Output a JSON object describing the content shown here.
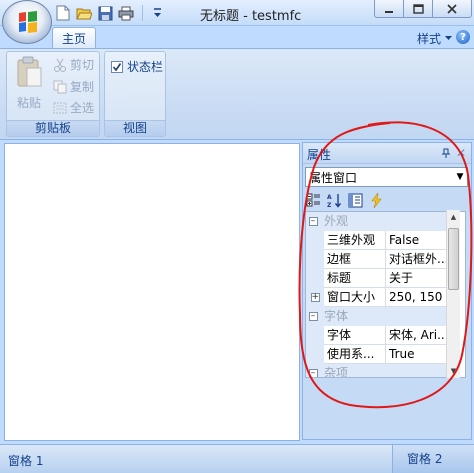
{
  "window": {
    "title": "无标题 - testmfc"
  },
  "quick_access": {
    "icons": [
      "new-file-icon",
      "open-folder-icon",
      "save-icon",
      "print-icon",
      "customize-dropdown-icon"
    ]
  },
  "ribbon": {
    "tabs": [
      {
        "label": "主页",
        "selected": true
      }
    ],
    "style_menu_label": "样式",
    "groups": {
      "clipboard": {
        "label": "剪贴板",
        "paste_label": "粘贴",
        "cut_label": "剪切",
        "copy_label": "复制",
        "select_all_label": "全选"
      },
      "view": {
        "label": "视图",
        "status_bar_label": "状态栏",
        "status_bar_checked": true
      }
    }
  },
  "properties_pane": {
    "title": "属性",
    "object_selector": "属性窗口",
    "categories": [
      {
        "name": "外观",
        "expanded": true,
        "properties": [
          {
            "name": "三维外观",
            "value": "False"
          },
          {
            "name": "边框",
            "value": "对话框外..."
          },
          {
            "name": "标题",
            "value": "关于"
          },
          {
            "name": "窗口大小",
            "value": "250, 150",
            "expandable": true
          }
        ]
      },
      {
        "name": "字体",
        "expanded": true,
        "properties": [
          {
            "name": "字体",
            "value": "宋体, Ari..."
          },
          {
            "name": "使用系...",
            "value": "True"
          }
        ]
      },
      {
        "name": "杂项",
        "expanded": true,
        "properties": []
      }
    ]
  },
  "status_bar": {
    "pane1": "窗格 1",
    "pane2": "窗格 2"
  },
  "colors": {
    "ribbon_blue": "#bfdbff",
    "annotation_red": "#e01818",
    "text_blue": "#15428b"
  }
}
